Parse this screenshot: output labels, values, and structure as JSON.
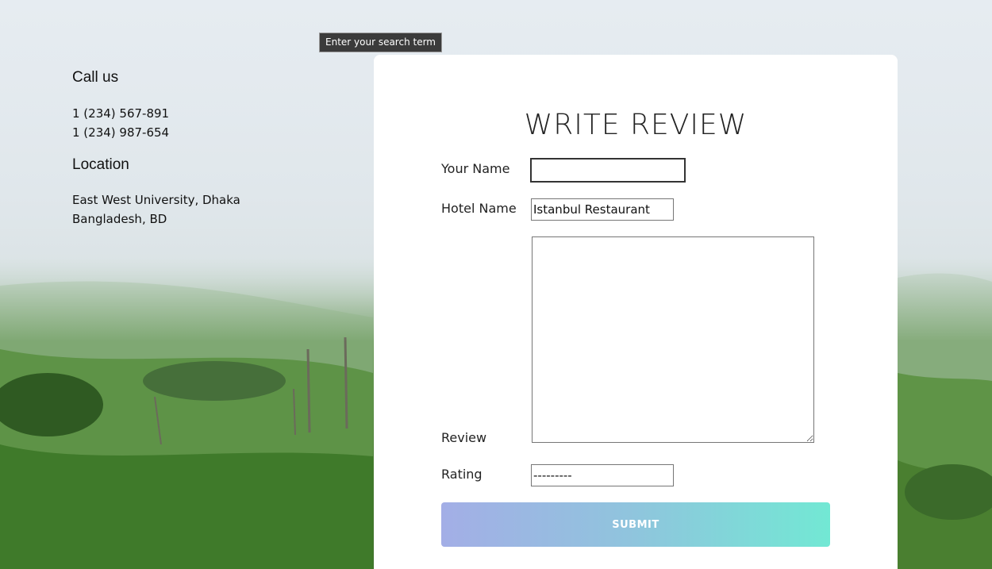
{
  "tooltip": "Enter your search term",
  "contact": {
    "call_heading": "Call us",
    "phones": [
      "1 (234) 567-891",
      "1 (234) 987-654"
    ],
    "location_heading": "Location",
    "address_lines": [
      "East West University, Dhaka",
      "Bangladesh, BD"
    ]
  },
  "form": {
    "title": "WRITE REVIEW",
    "your_name_label": "Your Name",
    "your_name_value": "",
    "hotel_name_label": "Hotel Name",
    "hotel_name_value": "Istanbul Restaurant",
    "review_label": "Review",
    "review_value": "",
    "rating_label": "Rating",
    "rating_value": "---------",
    "submit_label": "SUBMIT"
  },
  "colors": {
    "submit_gradient_start": "#a3aee6",
    "submit_gradient_end": "#72e8d4",
    "card_background": "#ffffff"
  }
}
